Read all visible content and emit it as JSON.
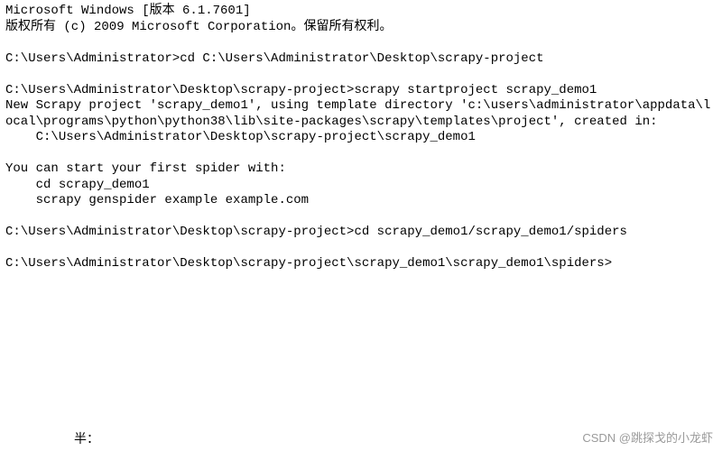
{
  "terminal": {
    "lines": [
      "Microsoft Windows [版本 6.1.7601]",
      "版权所有 (c) 2009 Microsoft Corporation。保留所有权利。",
      "",
      "C:\\Users\\Administrator>cd C:\\Users\\Administrator\\Desktop\\scrapy-project",
      "",
      "C:\\Users\\Administrator\\Desktop\\scrapy-project>scrapy startproject scrapy_demo1",
      "New Scrapy project 'scrapy_demo1', using template directory 'c:\\users\\administrator\\appdata\\local\\programs\\python\\python38\\lib\\site-packages\\scrapy\\templates\\project', created in:",
      "    C:\\Users\\Administrator\\Desktop\\scrapy-project\\scrapy_demo1",
      "",
      "You can start your first spider with:",
      "    cd scrapy_demo1",
      "    scrapy genspider example example.com",
      "",
      "C:\\Users\\Administrator\\Desktop\\scrapy-project>cd scrapy_demo1/scrapy_demo1/spiders",
      "",
      "C:\\Users\\Administrator\\Desktop\\scrapy-project\\scrapy_demo1\\scrapy_demo1\\spiders>"
    ]
  },
  "watermark": "CSDN @跳探戈的小龙虾",
  "bottom_fragment": "半："
}
